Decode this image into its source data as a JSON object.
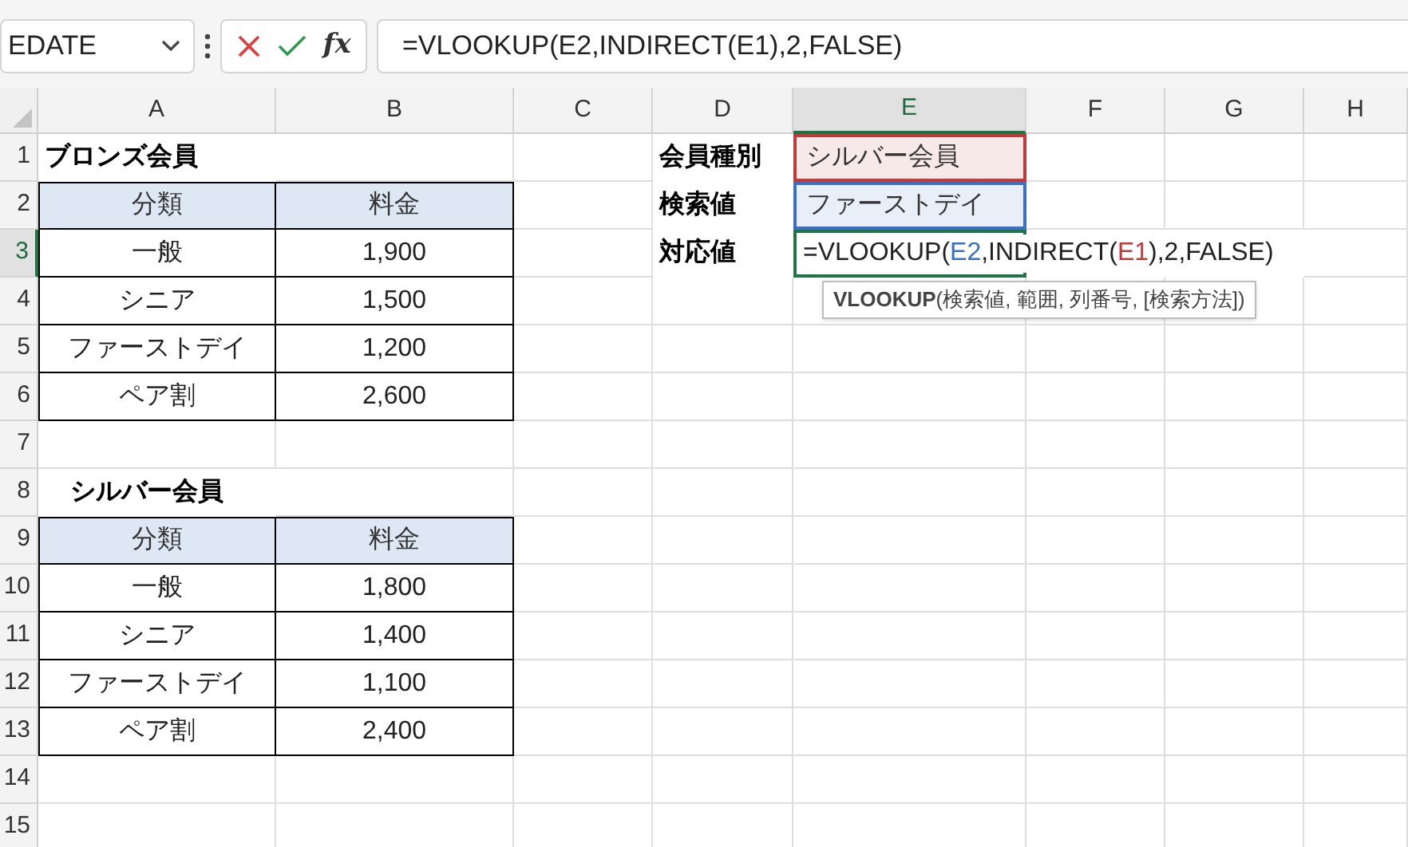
{
  "name_box": "EDATE",
  "fx_label": "fx",
  "formula_bar": "=VLOOKUP(E2,INDIRECT(E1),2,FALSE)",
  "column_headers": [
    {
      "label": "A",
      "selected": false
    },
    {
      "label": "B",
      "selected": false
    },
    {
      "label": "C",
      "selected": false
    },
    {
      "label": "D",
      "selected": false
    },
    {
      "label": "E",
      "selected": true
    },
    {
      "label": "F",
      "selected": false
    },
    {
      "label": "G",
      "selected": false
    },
    {
      "label": "H",
      "selected": false
    }
  ],
  "row_headers": [
    {
      "label": "1",
      "selected": false
    },
    {
      "label": "2",
      "selected": false
    },
    {
      "label": "3",
      "selected": true
    },
    {
      "label": "4",
      "selected": false
    },
    {
      "label": "5",
      "selected": false
    },
    {
      "label": "6",
      "selected": false
    },
    {
      "label": "7",
      "selected": false
    },
    {
      "label": "8",
      "selected": false
    },
    {
      "label": "9",
      "selected": false
    },
    {
      "label": "10",
      "selected": false
    },
    {
      "label": "11",
      "selected": false
    },
    {
      "label": "12",
      "selected": false
    },
    {
      "label": "13",
      "selected": false
    },
    {
      "label": "14",
      "selected": false
    },
    {
      "label": "15",
      "selected": false
    }
  ],
  "tables": [
    {
      "title": "ブロンズ会員",
      "header": [
        "分類",
        "料金"
      ],
      "rows": [
        [
          "一般",
          "1,900"
        ],
        [
          "シニア",
          "1,500"
        ],
        [
          "ファーストデイ",
          "1,200"
        ],
        [
          "ペア割",
          "2,600"
        ]
      ]
    },
    {
      "title": "シルバー会員",
      "header": [
        "分類",
        "料金"
      ],
      "rows": [
        [
          "一般",
          "1,800"
        ],
        [
          "シニア",
          "1,400"
        ],
        [
          "ファーストデイ",
          "1,100"
        ],
        [
          "ペア割",
          "2,400"
        ]
      ]
    }
  ],
  "lookup": [
    {
      "label": "会員種別",
      "value": "シルバー会員",
      "color": "#c0393b"
    },
    {
      "label": "検索値",
      "value": "ファーストデイ",
      "color": "#3a6fc4"
    }
  ],
  "result": {
    "label": "対応値",
    "formula_parts": [
      {
        "text": "=VLOOKUP("
      },
      {
        "text": "E2",
        "color": "#3a6fc4"
      },
      {
        "text": ",INDIRECT("
      },
      {
        "text": "E1",
        "color": "#c0393b"
      },
      {
        "text": "),2,FALSE)"
      }
    ]
  },
  "tooltip": {
    "function": "VLOOKUP",
    "args": "(検索値, 範囲, 列番号, [検索方法])"
  }
}
